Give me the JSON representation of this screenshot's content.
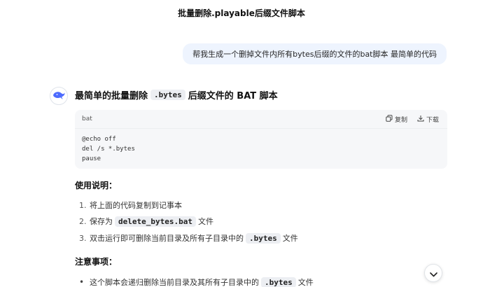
{
  "chat": {
    "title": "批量删除.playable后缀文件脚本"
  },
  "user_message": "帮我生成一个删掉文件内所有bytes后缀的文件的bat脚本 最简单的代码",
  "assistant": {
    "avatar_icon": "whale-logo-icon",
    "heading_prefix": "最简单的批量删除",
    "heading_code": ".bytes",
    "heading_suffix": "后缀文件的 BAT 脚本",
    "code": {
      "language": "bat",
      "copy_label": "复制",
      "download_label": "下载",
      "lines": [
        "@echo off",
        "del /s *.bytes",
        "pause"
      ]
    },
    "usage": {
      "title": "使用说明：",
      "items": [
        {
          "num": "1.",
          "text": "将上面的代码复制到记事本"
        },
        {
          "num": "2.",
          "prefix": "保存为",
          "code": "delete_bytes.bat",
          "suffix": "文件"
        },
        {
          "num": "3.",
          "prefix": "双击运行即可删除当前目录及所有子目录中的",
          "code": ".bytes",
          "suffix": "文件"
        }
      ]
    },
    "notes": {
      "title": "注意事项：",
      "items": [
        {
          "prefix": "这个脚本会递归删除当前目录及其所有子目录中的",
          "code": ".bytes",
          "suffix": "文件"
        }
      ]
    }
  },
  "colors": {
    "bubble": "#eef4fe",
    "code_bg": "#f6f7f9",
    "accent": "#4d6bfe"
  }
}
